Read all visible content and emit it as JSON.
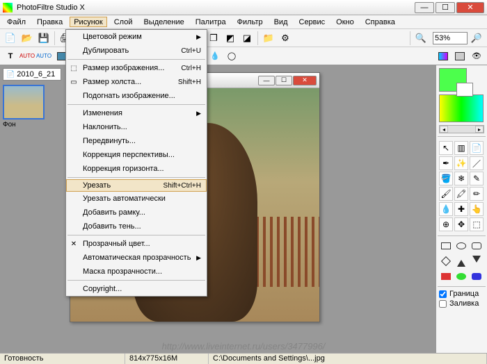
{
  "title": "PhotoFiltre Studio X",
  "menu": [
    "Файл",
    "Правка",
    "Рисунок",
    "Слой",
    "Выделение",
    "Палитра",
    "Фильтр",
    "Вид",
    "Сервис",
    "Окно",
    "Справка"
  ],
  "active_menu_index": 2,
  "zoom": "53%",
  "doc_tab": "2010_6_21",
  "layer_label": "Фон",
  "dropdown": [
    {
      "t": "item",
      "label": "Цветовой режим",
      "arrow": true
    },
    {
      "t": "item",
      "label": "Дублировать",
      "shortcut": "Ctrl+U"
    },
    {
      "t": "sep"
    },
    {
      "t": "item",
      "label": "Размер изображения...",
      "shortcut": "Ctrl+H",
      "icon": "⬚"
    },
    {
      "t": "item",
      "label": "Размер холста...",
      "shortcut": "Shift+H",
      "icon": "▭"
    },
    {
      "t": "item",
      "label": "Подогнать изображение..."
    },
    {
      "t": "sep"
    },
    {
      "t": "item",
      "label": "Изменения",
      "arrow": true
    },
    {
      "t": "item",
      "label": "Наклонить..."
    },
    {
      "t": "item",
      "label": "Передвинуть..."
    },
    {
      "t": "item",
      "label": "Коррекция перспективы..."
    },
    {
      "t": "item",
      "label": "Коррекция горизонта..."
    },
    {
      "t": "sep"
    },
    {
      "t": "item",
      "label": "Урезать",
      "shortcut": "Shift+Ctrl+H",
      "hl": true
    },
    {
      "t": "item",
      "label": "Урезать автоматически"
    },
    {
      "t": "item",
      "label": "Добавить рамку..."
    },
    {
      "t": "item",
      "label": "Добавить тень..."
    },
    {
      "t": "sep"
    },
    {
      "t": "item",
      "label": "Прозрачный цвет...",
      "icon": "✕"
    },
    {
      "t": "item",
      "label": "Автоматическая прозрачность",
      "arrow": true
    },
    {
      "t": "item",
      "label": "Маска прозрачности..."
    },
    {
      "t": "sep"
    },
    {
      "t": "item",
      "label": "Copyright..."
    }
  ],
  "checks": {
    "border": "Граница",
    "fill": "Заливка"
  },
  "status": {
    "ready": "Готовность",
    "dims": "814x775x16M",
    "path": "C:\\Documents and Settings\\...jpg"
  },
  "watermark": "http://www.liveinternet.ru/users/3477996/"
}
